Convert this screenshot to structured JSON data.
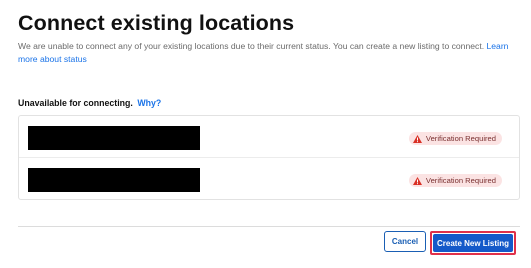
{
  "header": {
    "title": "Connect existing locations",
    "description": "We are unable to connect any of your existing locations due to their current status. You can create a new listing to connect. ",
    "learn_more_link": "Learn more about status"
  },
  "unavailable": {
    "label": "Unavailable for connecting.",
    "why_link": "Why?"
  },
  "locations": [
    {
      "name_redacted": true,
      "status": "Verification Required"
    },
    {
      "name_redacted": true,
      "status": "Verification Required"
    }
  ],
  "colors": {
    "link": "#1a73e8",
    "primary_button": "#1459c9",
    "highlight_outline": "#e0304a",
    "badge_bg": "#fbe3e3",
    "warning_icon": "#d93025"
  },
  "icons": {
    "status": "warning-triangle-icon"
  },
  "footer": {
    "cancel_label": "Cancel",
    "create_label": "Create New Listing"
  }
}
